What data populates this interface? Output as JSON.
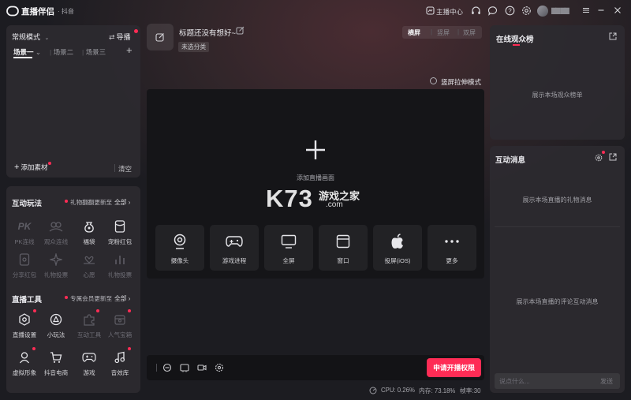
{
  "titlebar": {
    "app_name": "直播伴侣",
    "platform": "· 抖音",
    "host_center": "主播中心",
    "username": "▇▇ ▇▇"
  },
  "left": {
    "mode_label": "常规模式",
    "guide_label": "导播",
    "scenes": [
      "场景一",
      "场景二",
      "场景三"
    ],
    "add_material": "添加素材",
    "clear": "清空",
    "interactive": {
      "title": "互动玩法",
      "note": "礼物翻翻更新至",
      "all": "全部",
      "items": [
        {
          "label": "PK连线"
        },
        {
          "label": "观众连线"
        },
        {
          "label": "福袋"
        },
        {
          "label": "宠粉红包"
        },
        {
          "label": "分享红包"
        },
        {
          "label": "礼物投票"
        },
        {
          "label": "心愿"
        },
        {
          "label": "礼物投票"
        }
      ]
    },
    "tools": {
      "title": "直播工具",
      "note": "专属会员更新至",
      "all": "全部",
      "items": [
        {
          "label": "直播设置"
        },
        {
          "label": "小玩法"
        },
        {
          "label": "互动工具"
        },
        {
          "label": "人气宝箱"
        },
        {
          "label": "虚拟形象"
        },
        {
          "label": "抖音电商"
        },
        {
          "label": "游戏"
        },
        {
          "label": "音效库"
        }
      ]
    }
  },
  "center": {
    "stream_title": "标题还没有想好~",
    "category": "未选分类",
    "orientation": [
      "横屏",
      "竖屏",
      "双屏"
    ],
    "stretch_mode": "竖屏拉伸模式",
    "add_source": "添加直播画面",
    "watermark": {
      "logo": "K73",
      "cn": "游戏之家",
      "domain": ".com"
    },
    "sources": [
      {
        "label": "摄像头"
      },
      {
        "label": "游戏进程"
      },
      {
        "label": "全屏"
      },
      {
        "label": "窗口"
      },
      {
        "label": "投屏(iOS)"
      },
      {
        "label": "更多"
      }
    ],
    "apply_button": "申请开播权限",
    "stats": {
      "cpu": "CPU: 0.26%",
      "memory": "内存: 73.18%",
      "fps": "帧率:30"
    }
  },
  "right": {
    "audience_title": "在线观众榜",
    "audience_empty": "展示本场观众榜单",
    "messages_title": "互动消息",
    "gift_empty": "展示本场直播的礼物消息",
    "comment_empty": "展示本场直播的评论互动消息",
    "chat_placeholder": "说点什么...",
    "send": "发送"
  },
  "colors": {
    "accent": "#fe2c55",
    "background": "#1c1c21",
    "panel": "#2c2a30"
  }
}
